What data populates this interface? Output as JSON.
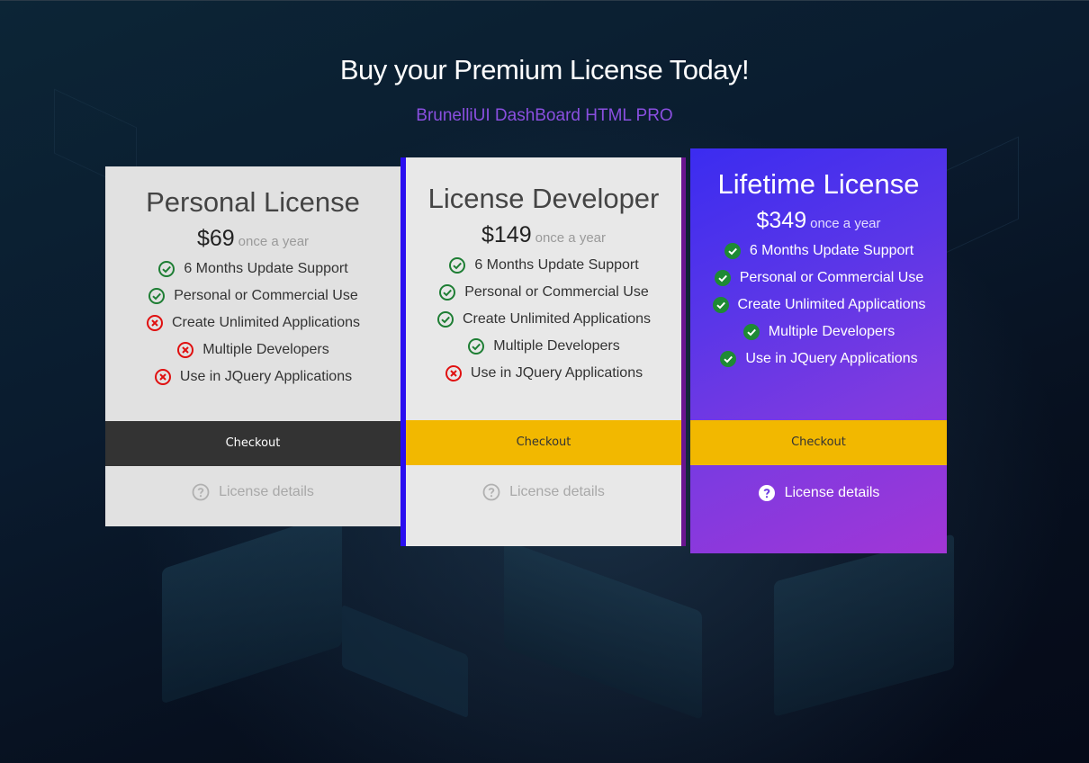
{
  "header": {
    "title": "Buy your Premium License Today!",
    "subtitle": "BrunelliUI DashBoard HTML PRO"
  },
  "colors": {
    "accent_purple": "#8a4fe0",
    "checkout_yellow": "#f2b800",
    "checkout_dark": "#333333",
    "check_green": "#1e7e34",
    "cross_red": "#e01010"
  },
  "plans": [
    {
      "name": "Personal License",
      "price": "$69",
      "period": "once a year",
      "features": [
        {
          "label": "6 Months Update Support",
          "included": true,
          "icon": "check-circle-icon"
        },
        {
          "label": "Personal or Commercial Use",
          "included": true,
          "icon": "check-circle-icon"
        },
        {
          "label": "Create Unlimited Applications",
          "included": false,
          "icon": "x-circle-icon"
        },
        {
          "label": "Multiple Developers",
          "included": false,
          "icon": "x-circle-icon"
        },
        {
          "label": "Use in JQuery Applications",
          "included": false,
          "icon": "x-circle-icon"
        }
      ],
      "checkout_label": "Checkout",
      "details_label": "License details",
      "details_icon": "question-circle-icon"
    },
    {
      "name": "License Developer",
      "price": "$149",
      "period": "once a year",
      "features": [
        {
          "label": "6 Months Update Support",
          "included": true,
          "icon": "check-circle-icon"
        },
        {
          "label": "Personal or Commercial Use",
          "included": true,
          "icon": "check-circle-icon"
        },
        {
          "label": "Create Unlimited Applications",
          "included": true,
          "icon": "check-circle-icon"
        },
        {
          "label": "Multiple Developers",
          "included": true,
          "icon": "check-circle-icon"
        },
        {
          "label": "Use in JQuery Applications",
          "included": false,
          "icon": "x-circle-icon"
        }
      ],
      "checkout_label": "Checkout",
      "details_label": "License details",
      "details_icon": "question-circle-icon"
    },
    {
      "name": "Lifetime License",
      "price": "$349",
      "period": "once a year",
      "features": [
        {
          "label": "6 Months Update Support",
          "included": true,
          "icon": "check-circle-filled-icon"
        },
        {
          "label": "Personal or Commercial Use",
          "included": true,
          "icon": "check-circle-filled-icon"
        },
        {
          "label": "Create Unlimited Applications",
          "included": true,
          "icon": "check-circle-filled-icon"
        },
        {
          "label": "Multiple Developers",
          "included": true,
          "icon": "check-circle-filled-icon"
        },
        {
          "label": "Use in JQuery Applications",
          "included": true,
          "icon": "check-circle-filled-icon"
        }
      ],
      "checkout_label": "Checkout",
      "details_label": "License details",
      "details_icon": "question-circle-filled-icon"
    }
  ]
}
